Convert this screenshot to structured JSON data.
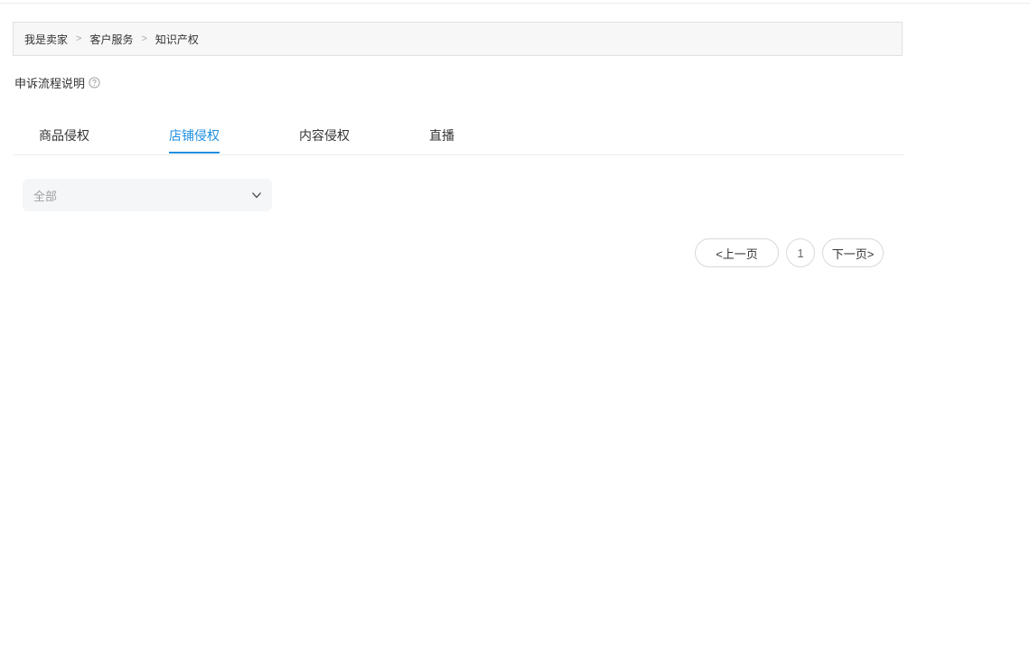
{
  "breadcrumb": {
    "items": [
      "我是卖家",
      "客户服务",
      "知识产权"
    ],
    "separator": ">"
  },
  "appeal": {
    "label": "申诉流程说明",
    "icon": "help-circle-icon"
  },
  "tabs": [
    {
      "label": "商品侵权",
      "active": false
    },
    {
      "label": "店铺侵权",
      "active": true
    },
    {
      "label": "内容侵权",
      "active": false
    },
    {
      "label": "直播",
      "active": false
    }
  ],
  "filter": {
    "value": "全部",
    "icon": "chevron-down-icon"
  },
  "pagination": {
    "prev_label": "<上一页",
    "current_page": "1",
    "next_label": "下一页>"
  },
  "colors": {
    "accent": "#1f8fe0",
    "breadcrumb_bg": "#f7f7f7",
    "select_bg": "#f5f6f8"
  }
}
